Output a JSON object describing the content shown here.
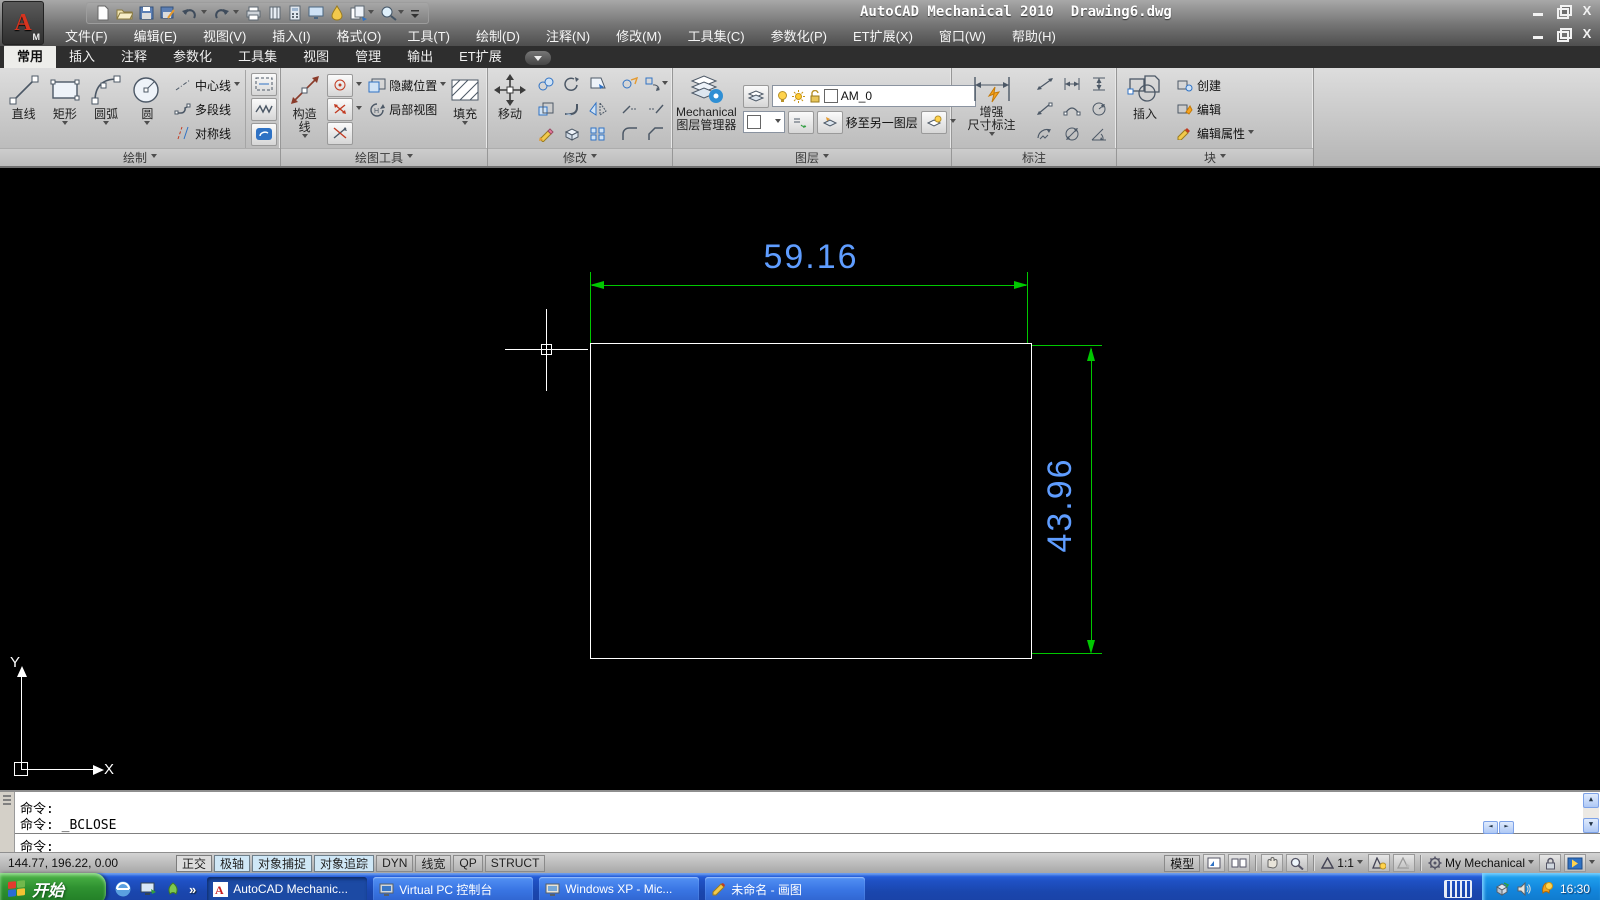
{
  "titlebar": {
    "title": "AutoCAD Mechanical 2010  Drawing6.dwg"
  },
  "menu": {
    "items": [
      "文件(F)",
      "编辑(E)",
      "视图(V)",
      "插入(I)",
      "格式(O)",
      "工具(T)",
      "绘制(D)",
      "注释(N)",
      "修改(M)",
      "工具集(C)",
      "参数化(P)",
      "ET扩展(X)",
      "窗口(W)",
      "帮助(H)"
    ]
  },
  "ribbon": {
    "tabs": [
      {
        "label": "常用",
        "active": true
      },
      {
        "label": "插入",
        "active": false
      },
      {
        "label": "注释",
        "active": false
      },
      {
        "label": "参数化",
        "active": false
      },
      {
        "label": "工具集",
        "active": false
      },
      {
        "label": "视图",
        "active": false
      },
      {
        "label": "管理",
        "active": false
      },
      {
        "label": "输出",
        "active": false
      },
      {
        "label": "ET扩展",
        "active": false
      }
    ],
    "panels": {
      "draw": {
        "title": "绘制",
        "line": "直线",
        "rect": "矩形",
        "arc": "圆弧",
        "circle": "圆",
        "centerline": "中心线",
        "polyline": "多段线",
        "symline": "对称线"
      },
      "drawtools": {
        "title": "绘图工具",
        "constr1": "构造",
        "constr2": "线",
        "hidepos": "隐藏位置",
        "partialview": "局部视图",
        "hatch": "填充"
      },
      "modify": {
        "title": "修改",
        "move": "移动"
      },
      "layers": {
        "title": "图层",
        "mgr1": "Mechanical",
        "mgr2": "图层管理器",
        "layer_name": "AM_0",
        "move_layer": "移至另一图层"
      },
      "annotate": {
        "title": "标注",
        "power1": "增强",
        "power2": "尺寸标注"
      },
      "block": {
        "title": "块",
        "insert": "插入",
        "create": "创建",
        "edit": "编辑",
        "editattr": "编辑属性"
      }
    }
  },
  "canvas": {
    "dim_width": "59.16",
    "dim_height": "43.96",
    "axis_x": "X",
    "axis_y": "Y"
  },
  "command": {
    "line1": "命令:",
    "line2": "命令: _BCLOSE",
    "prompt": "命令:"
  },
  "statusbar": {
    "coords": "144.77, 196.22, 0.00",
    "toggles": [
      {
        "label": "正交",
        "state": "pressed"
      },
      {
        "label": "极轴",
        "state": "on"
      },
      {
        "label": "对象捕捉",
        "state": "on"
      },
      {
        "label": "对象追踪",
        "state": "on"
      },
      {
        "label": "DYN",
        "state": "off"
      },
      {
        "label": "线宽",
        "state": "off"
      },
      {
        "label": "QP",
        "state": "off"
      },
      {
        "label": "STRUCT",
        "state": "off"
      }
    ],
    "model": "模型",
    "scale": "1:1",
    "workspace": "My Mechanical"
  },
  "taskbar": {
    "start": "开始",
    "chevron": "»",
    "tasks": [
      {
        "label": "AutoCAD Mechanic...",
        "active": true
      },
      {
        "label": "Virtual PC 控制台",
        "active": false
      },
      {
        "label": "Windows XP - Mic...",
        "active": false
      },
      {
        "label": "未命名 - 画图",
        "active": false
      }
    ],
    "time": "16:30"
  }
}
